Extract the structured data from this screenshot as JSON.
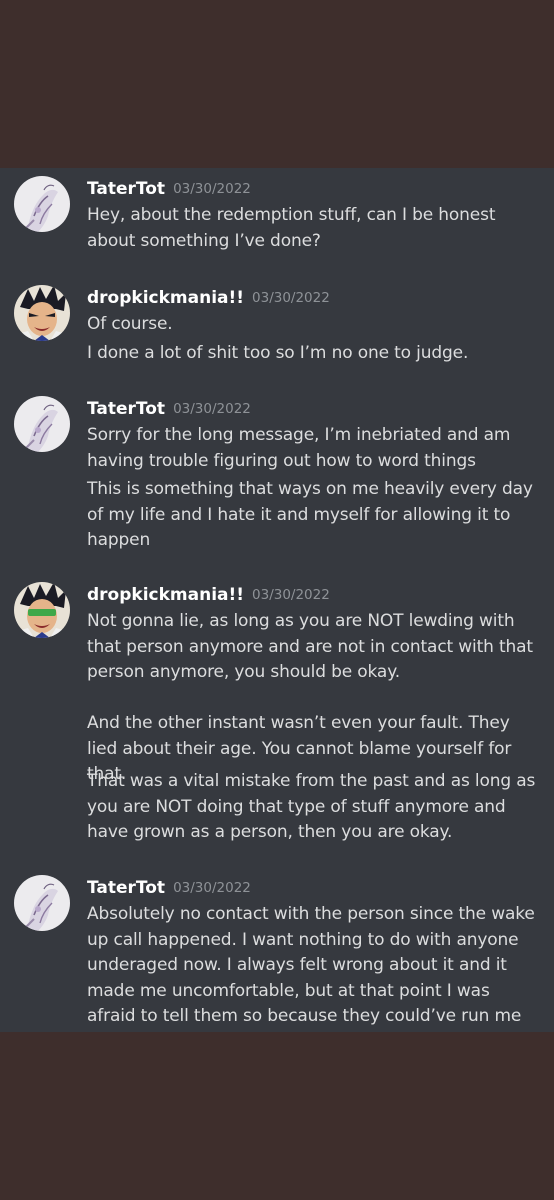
{
  "messages": [
    {
      "username": "TaterTot",
      "timestamp": "03/30/2022",
      "avatar_icon": "tatertot-avatar",
      "lines": [
        "Hey, about the redemption stuff, can I be honest about something I’ve done?"
      ]
    },
    {
      "username": "dropkickmania!!",
      "timestamp": "03/30/2022",
      "avatar_icon": "anime-character-avatar",
      "lines": [
        "Of course.",
        "I done a lot of shit too so I’m no one to judge."
      ]
    },
    {
      "username": "TaterTot",
      "timestamp": "03/30/2022",
      "avatar_icon": "tatertot-avatar",
      "lines": [
        "Sorry for the long message, I’m inebriated and am having trouble figuring out how to word things",
        "This is something that ways on me heavily every day of my life and I hate it and myself for allowing it to happen"
      ]
    },
    {
      "username": "dropkickmania!!",
      "timestamp": "03/30/2022",
      "avatar_icon": "anime-character-avatar",
      "lines": [
        "Not gonna lie, as long as you are NOT lewding with that person anymore and are not in contact with that person anymore, you should be okay.\n\nAnd the other instant wasn’t even your fault. They lied about their age. You cannot blame yourself for that.",
        "That was a vital mistake from the past and as long as you are NOT doing that type of stuff anymore and have grown as a person, then you are okay."
      ]
    },
    {
      "username": "TaterTot",
      "timestamp": "03/30/2022",
      "avatar_icon": "tatertot-avatar",
      "lines": [
        "Absolutely no contact with the person since the wake up call happened. I want nothing to do with anyone underaged now. I always felt wrong about it and it made me uncomfortable, but at that point I was afraid to tell them so because they could’ve run me off."
      ]
    }
  ],
  "colors": {
    "outer_background": "#3e2e2c",
    "chat_background": "#36393f",
    "username": "#ffffff",
    "timestamp": "#8e9297",
    "message_text": "#dcddde"
  }
}
